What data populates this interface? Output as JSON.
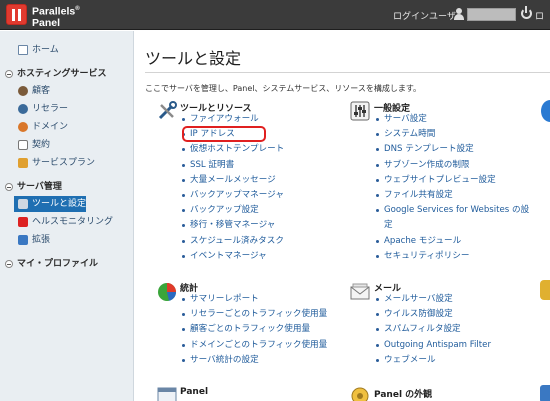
{
  "header": {
    "brand_line1": "Parallels",
    "brand_sup": "®",
    "brand_line2": "Panel",
    "user_label": "ログインユーザ:",
    "logout": "ロ"
  },
  "sidebar": {
    "home": "ホーム",
    "hosting_section": "ホスティングサービス",
    "hosting_items": [
      "顧客",
      "リセラー",
      "ドメイン",
      "契約",
      "サービスプラン"
    ],
    "server_section": "サーバ管理",
    "server_items": [
      "ツールと設定",
      "ヘルスモニタリング",
      "拡張"
    ],
    "profile_section": "マイ・プロファイル"
  },
  "main": {
    "title": "ツールと設定",
    "intro": "ここでサーバを管理し、Panel、システムサービス、リソースを構成します。",
    "groups": {
      "tools": {
        "title": "ツールとリソース",
        "items": [
          "ファイアウォール",
          "IP アドレス",
          "仮想ホストテンプレート",
          "SSL 証明書",
          "大量メールメッセージ",
          "バックアップマネージャ",
          "バックアップ設定",
          "移行・移管マネージャ",
          "スケジュール済みタスク",
          "イベントマネージャ"
        ]
      },
      "general": {
        "title": "一般設定",
        "items": [
          "サーバ設定",
          "システム時間",
          "DNS テンプレート設定",
          "サブゾーン作成の制限",
          "ウェブサイトプレビュー設定",
          "ファイル共有設定",
          "Google Services for Websites の設",
          "定",
          "Apache モジュール",
          "セキュリティポリシー"
        ]
      },
      "stats": {
        "title": "統計",
        "items": [
          "サマリーレポート",
          "リセラーごとのトラフィック使用量",
          "顧客ごとのトラフィック使用量",
          "ドメインごとのトラフィック使用量",
          "サーバ統計の設定"
        ]
      },
      "mail": {
        "title": "メール",
        "items": [
          "メールサーバ設定",
          "ウイルス防御設定",
          "スパムフィルタ設定",
          "Outgoing Antispam Filter",
          "ウェブメール"
        ]
      },
      "panel": {
        "title": "Panel"
      },
      "appearance": {
        "title": "Panel の外観"
      }
    }
  },
  "colors": {
    "topbar": "#3b3b3b",
    "sidebar_bg": "#e9eef2",
    "active_nav": "#1f6fb2",
    "link": "#1f5b9b",
    "highlight": "#e02020"
  }
}
